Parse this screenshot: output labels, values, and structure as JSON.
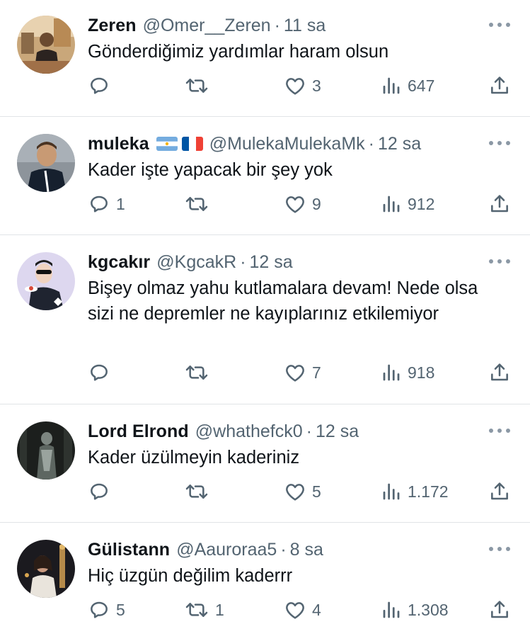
{
  "tweets": [
    {
      "name": "Zeren",
      "flags": [],
      "handle": "@Omer__Zeren",
      "time": "11 sa",
      "text": "Gönderdiğimiz yardımlar haram olsun",
      "replies": "",
      "retweets": "",
      "likes": "3",
      "views": "647"
    },
    {
      "name": "muleka",
      "flags": [
        "argentina-flag",
        "france-flag"
      ],
      "handle": "@MulekaMulekaMk",
      "time": "12 sa",
      "text": "Kader işte yapacak bir şey yok",
      "replies": "1",
      "retweets": "",
      "likes": "9",
      "views": "912"
    },
    {
      "name": "kgcakır",
      "flags": [],
      "handle": "@KgcakR",
      "time": "12 sa",
      "text": "Bişey olmaz yahu kutlamalara devam! Nede olsa sizi ne depremler ne kayıplarınız etkilemiyor",
      "replies": "",
      "retweets": "",
      "likes": "7",
      "views": "918"
    },
    {
      "name": "Lord Elrond",
      "flags": [],
      "handle": "@whathefck0",
      "time": "12 sa",
      "text": "Kader üzülmeyin kaderiniz",
      "replies": "",
      "retweets": "",
      "likes": "5",
      "views": "1.172"
    },
    {
      "name": "Gülistann",
      "flags": [],
      "handle": "@Aauroraa5",
      "time": "8 sa",
      "text": "Hiç üzgün değilim kaderrr",
      "replies": "5",
      "retweets": "1",
      "likes": "4",
      "views": "1.308"
    }
  ],
  "separator": "·",
  "icons": {
    "reply": "reply-icon",
    "retweet": "retweet-icon",
    "like": "like-icon",
    "views": "views-icon",
    "share": "share-icon",
    "more": "more-icon"
  },
  "colors": {
    "text": "#0f1419",
    "muted": "#536471",
    "divider": "#e1e4e7"
  }
}
